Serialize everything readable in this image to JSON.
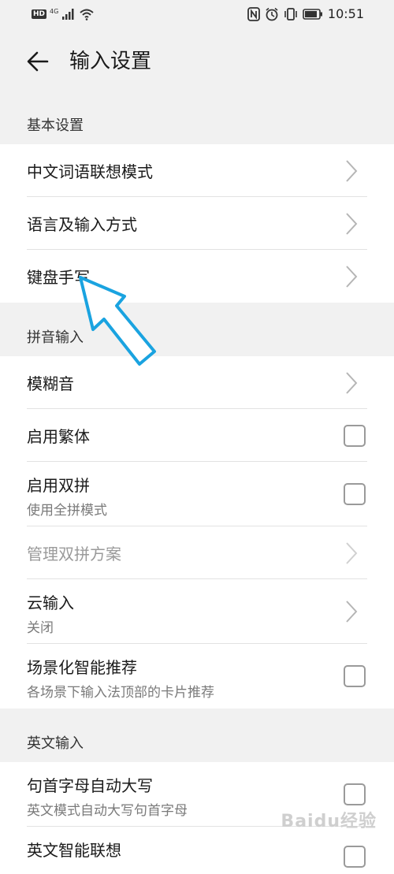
{
  "status_bar": {
    "hd": "HD",
    "network": "4G",
    "time": "10:51",
    "icons": [
      "hd-icon",
      "signal-icon",
      "wifi-icon",
      "nfc-icon",
      "alarm-icon",
      "vibrate-icon",
      "battery-icon"
    ]
  },
  "header": {
    "title": "输入设置",
    "back_icon": "arrow-left-icon"
  },
  "sections": {
    "basic": {
      "title": "基本设置",
      "items": [
        "中文词语联想模式",
        "语言及输入方式",
        "键盘手写"
      ]
    },
    "pinyin": {
      "title": "拼音输入",
      "fuzzy": "模糊音",
      "traditional": "启用繁体",
      "shuangpin": {
        "label": "启用双拼",
        "sub": "使用全拼模式"
      },
      "manage": "管理双拼方案",
      "cloud": {
        "label": "云输入",
        "sub": "关闭"
      },
      "scene": {
        "label": "场景化智能推荐",
        "sub": "各场景下输入法顶部的卡片推荐"
      }
    },
    "english": {
      "title": "英文输入",
      "capitalize": {
        "label": "句首字母自动大写",
        "sub": "英文模式自动大写句首字母"
      },
      "assoc": "英文智能联想"
    }
  },
  "watermark": "Baidu经验",
  "colors": {
    "background": "#f1f1f1",
    "annotation_arrow": "#1aa3e0",
    "checkbox_border": "#9a9a9a"
  }
}
